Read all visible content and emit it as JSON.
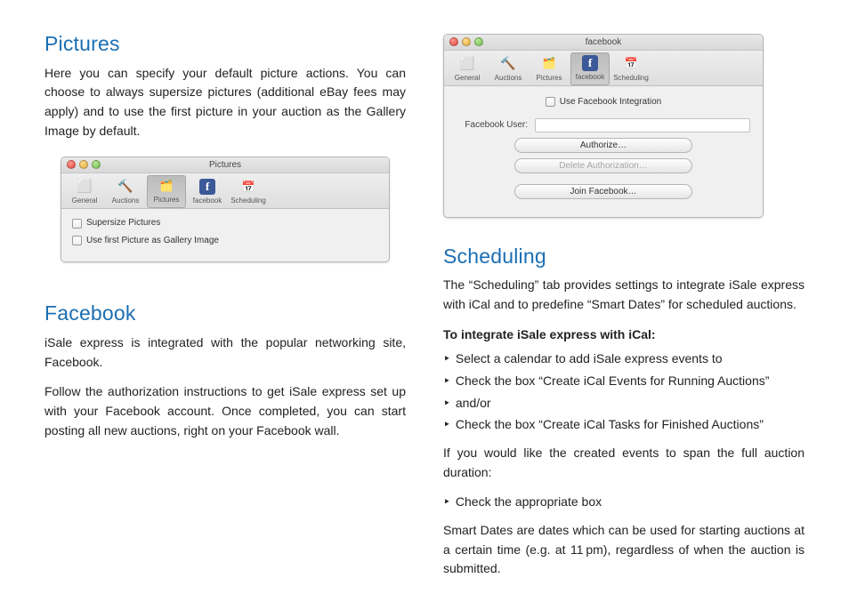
{
  "left": {
    "pictures": {
      "heading": "Pictures",
      "para": "Here you can specify your default picture actions. You can choose to always supersize pictures (additional eBay fees may apply) and to use the first picture in your auction as the Gallery Image by default."
    },
    "facebook": {
      "heading": "Facebook",
      "para1": "iSale express is integrated with the popular networking site, Facebook.",
      "para2": "Follow the authorization instructions to get iSale express set up with your Facebook account. Once completed, you can start posting all new auctions, right on your Facebook wall."
    }
  },
  "right": {
    "scheduling": {
      "heading": "Scheduling",
      "para": "The “Scheduling” tab provides settings to integrate iSale express with iCal and to predefine “Smart Dates” for scheduled auctions.",
      "sub": "To integrate iSale express with iCal:",
      "bullets": [
        "Select a calendar to add iSale express events to",
        "Check the box “Create iCal Events for Running Auctions”",
        "and/or",
        "Check the box “Create iCal Tasks for Finished Auctions”"
      ],
      "para2": "If you would like the created events to span the full auction duration:",
      "bullets2": [
        "Check the appropriate box"
      ],
      "para3": "Smart Dates are dates which can be used for starting auctions at a certain time (e.g. at 11 pm), regardless of when the auction is submitted."
    }
  },
  "win_pictures": {
    "title": "Pictures",
    "tabs": {
      "general": "General",
      "auctions": "Auctions",
      "pictures": "Pictures",
      "facebook": "facebook",
      "scheduling": "Scheduling"
    },
    "check1": "Supersize Pictures",
    "check2": "Use first Picture as Gallery Image"
  },
  "win_facebook": {
    "title": "facebook",
    "tabs": {
      "general": "General",
      "auctions": "Auctions",
      "pictures": "Pictures",
      "facebook": "facebook",
      "scheduling": "Scheduling"
    },
    "integration": "Use Facebook Integration",
    "userlabel": "Facebook User:",
    "btn_auth": "Authorize…",
    "btn_del": "Delete Authorization…",
    "btn_join": "Join Facebook…"
  },
  "arrow": "‣"
}
